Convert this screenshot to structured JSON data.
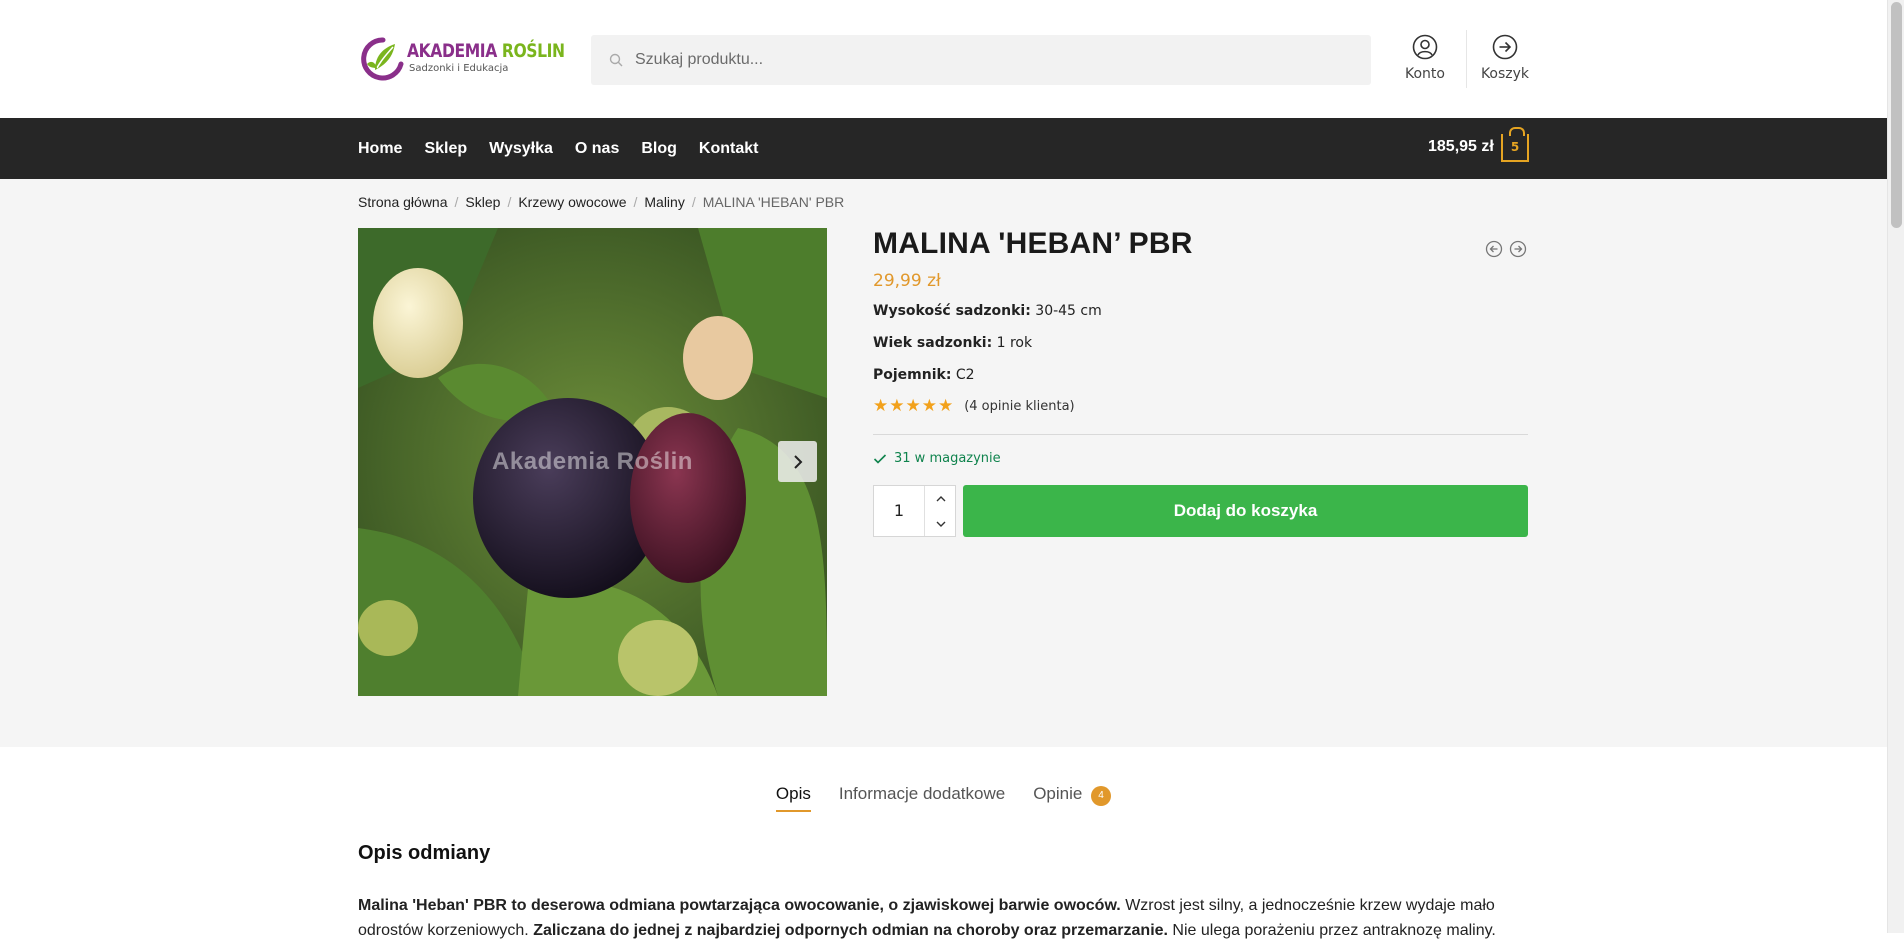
{
  "header": {
    "logo_main_a": "AKADEMIA",
    "logo_main_b": "ROŚLIN",
    "logo_sub": "Sadzonki i Edukacja",
    "search_placeholder": "Szukaj produktu...",
    "account_label": "Konto",
    "cart_label": "Koszyk"
  },
  "nav": {
    "items": [
      "Home",
      "Sklep",
      "Wysyłka",
      "O nas",
      "Blog",
      "Kontakt"
    ],
    "cart_total": "185,95 zł",
    "cart_count": "5"
  },
  "breadcrumb": [
    "Strona główna",
    "Sklep",
    "Krzewy owocowe",
    "Maliny",
    "MALINA 'HEBAN' PBR"
  ],
  "product": {
    "watermark": "Akademia Roślin",
    "title": "MALINA 'HEBAN’ PBR",
    "price": "29,99 zł",
    "attributes": [
      {
        "label": "Wysokość sadzonki:",
        "value": "30-45 cm"
      },
      {
        "label": "Wiek sadzonki:",
        "value": "1 rok"
      },
      {
        "label": "Pojemnik:",
        "value": "C2"
      }
    ],
    "rating": 5,
    "reviews_link": "(4 opinie klienta)",
    "stock": "31 w magazynie",
    "quantity": "1",
    "add_to_cart": "Dodaj do koszyka"
  },
  "tabs": {
    "items": [
      "Opis",
      "Informacje dodatkowe",
      "Opinie"
    ],
    "reviews_count": "4"
  },
  "description": {
    "heading": "Opis odmiany",
    "p1_bold1": "Malina 'Heban' PBR to deserowa odmiana powtarzająca owocowanie, o zjawiskowej barwie owoców.",
    "p1_text1": " Wzrost jest silny, a jednocześnie krzew wydaje mało odrostów korzeniowych. ",
    "p1_bold2": "Zaliczana do jednej z najbardziej odpornych odmian na choroby oraz przemarzanie.",
    "p1_text2": " Nie ulega porażeniu przez antraknozę maliny."
  },
  "colors": {
    "accent": "#e1982b",
    "nav_bg": "#262626",
    "button_green": "#3bb54a",
    "stock_green": "#0f834d"
  }
}
